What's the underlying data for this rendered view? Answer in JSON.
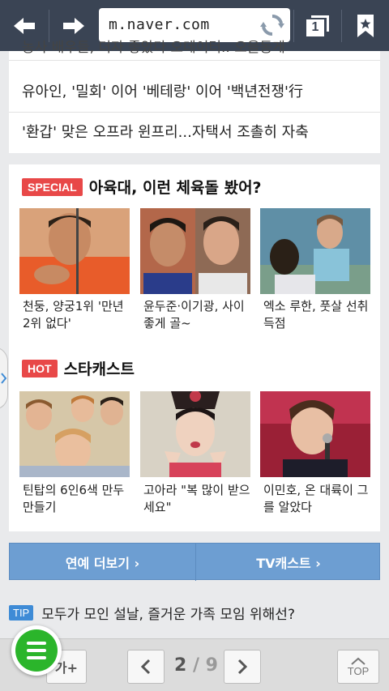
{
  "browser": {
    "url": "m.naver.com",
    "tab_count": "1",
    "back_icon": "arrow-left-icon",
    "forward_icon": "arrow-right-icon",
    "refresh_icon": "refresh-icon",
    "tabs_icon": "tabs-icon",
    "bookmark_icon": "bookmark-icon"
  },
  "news": {
    "partial_headline": "농사 배우들, 더자 좋았다 오데이터.. 오을동게",
    "items": [
      "유아인, '밀회' 이어 '베테랑' 이어 '백년전쟁'行",
      "'환갑' 맞은 오프라 윈프리...자택서 조촐히 자축"
    ]
  },
  "special": {
    "tag": "SPECIAL",
    "title": "아육대, 이런 체육돌 봤어?",
    "items": [
      {
        "caption": "천둥, 양궁1위 '만년 2위 없다'"
      },
      {
        "caption": "윤두준·이기광, 사이좋게 골~"
      },
      {
        "caption": "엑소 루한, 풋살 선취득점"
      }
    ]
  },
  "hot": {
    "tag": "HOT",
    "title": "스타캐스트",
    "items": [
      {
        "caption": "틴탑의 6인6색 만두만들기"
      },
      {
        "caption": "고아라 \"복 많이 받으세요\""
      },
      {
        "caption": "이민호, 온 대륙이 그를 알았다"
      }
    ]
  },
  "links": {
    "more_entertainment": "연예 더보기 ›",
    "tvcast": "TV캐스트 ›"
  },
  "tip": {
    "tag": "TIP",
    "text": "모두가 모인 설날, 즐거운 가족 모임 위해선?"
  },
  "bottom": {
    "font_label": "가+",
    "page_current": "2",
    "page_sep": " / ",
    "page_total": "9",
    "top_label": "TOP"
  },
  "colors": {
    "topbar": "#3a4454",
    "tag_red": "#e84848",
    "link_bar_blue": "#6d9ed2",
    "tip_blue": "#3e8bd6",
    "naver_green": "#2bb52b"
  }
}
